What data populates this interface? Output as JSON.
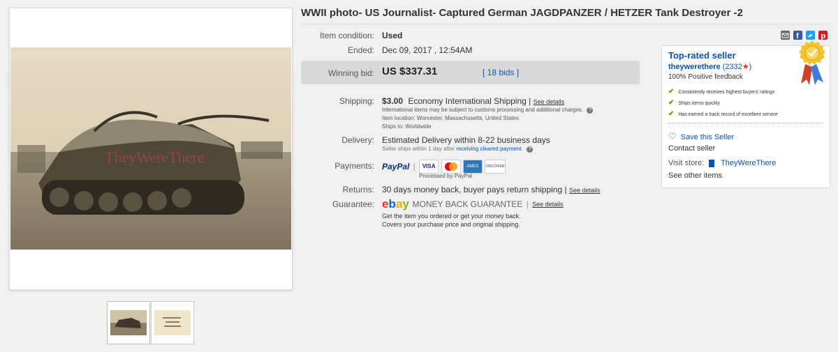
{
  "listing": {
    "title": "WWII photo- US Journalist- Captured German JAGDPANZER / HETZER Tank Destroyer -2",
    "watermark": "TheyWereThere"
  },
  "details": {
    "condition_label": "Item condition:",
    "condition_value": "Used",
    "ended_label": "Ended:",
    "ended_value": "Dec 09, 2017 , 12:54AM",
    "winning_bid_label": "Winning bid:",
    "winning_bid_value": "US $337.31",
    "bids_link": "[ 18 bids ]",
    "shipping_label": "Shipping:",
    "shipping_price": "$3.00",
    "shipping_method": "Economy International Shipping |",
    "see_details": "See details",
    "shipping_note": "International items may be subject to customs processing and additional charges.",
    "item_location": "Item location:  Worcester, Massachusetts, United States",
    "ships_to": "Ships to:  Worldwide",
    "delivery_label": "Delivery:",
    "delivery_value": "Estimated Delivery within 8-22 business days",
    "delivery_note": "Seller ships within 1 day after",
    "delivery_link": "receiving cleared payment",
    "delivery_dot": ".",
    "payments_label": "Payments:",
    "paypal": "PayPal",
    "processed_by": "Processed by PayPal",
    "returns_label": "Returns:",
    "returns_value": "30 days money back, buyer pays return shipping |",
    "guarantee_label": "Guarantee:",
    "ebay": "ebay",
    "money_back": "MONEY BACK GUARANTEE",
    "guarantee_sep": "|",
    "guarantee_text1": "Get the item you ordered or get your money back.",
    "guarantee_text2": "Covers your purchase price and original shipping."
  },
  "cards": [
    "VISA",
    "MC",
    "AMEX",
    "DISCOVER"
  ],
  "seller": {
    "badge": "Top-rated seller",
    "name": "theywerethere",
    "score_open": "(2332",
    "score_close": ")",
    "feedback": "100% Positive feedback",
    "features": [
      "Consistently receives highest buyers' ratings",
      "Ships items quickly",
      "Has earned a track record of excellent service"
    ],
    "save_seller": "Save this Seller",
    "contact_seller": "Contact seller",
    "visit_store_label": "Visit store:",
    "store_name": "TheyWereThere",
    "see_other_items": "See other items"
  },
  "icons": {
    "share": [
      "email-icon",
      "facebook-icon",
      "twitter-icon",
      "pinterest-icon"
    ]
  },
  "colors": {
    "link": "#0654ba",
    "check": "#5ba500",
    "star": "#e4370b",
    "paypal_blue": "#003087",
    "paypal_light": "#009cde"
  }
}
